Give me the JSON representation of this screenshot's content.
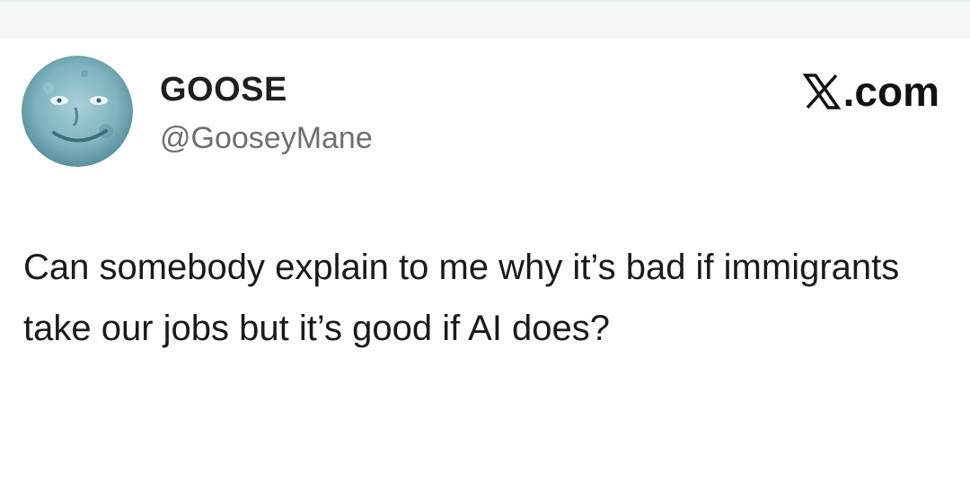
{
  "post": {
    "author": {
      "display_name": "GOOSE",
      "handle": "@GooseyMane",
      "avatar_icon": "moon-face-avatar"
    },
    "site": {
      "logo_icon": "x-logo-icon",
      "domain_suffix": ".com"
    },
    "body": "Can somebody explain to me why it’s bad if immigrants take our jobs but it’s good if AI does?"
  },
  "colors": {
    "background": "#ffffff",
    "top_strip": "#f5f6f6",
    "name_text": "#1f1f1f",
    "handle_text": "#6f6f6f",
    "body_text": "#1a1a1a",
    "avatar_tint": "#7fb3bf"
  }
}
